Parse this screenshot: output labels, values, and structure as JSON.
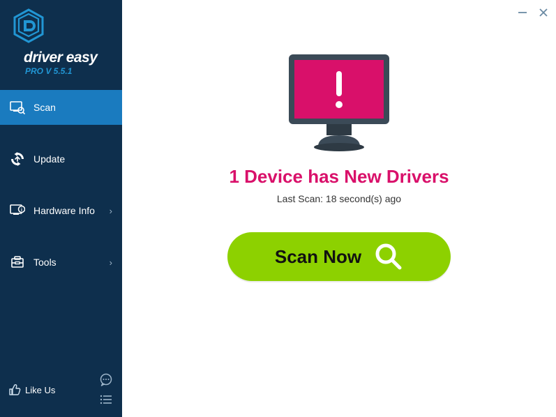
{
  "brand": {
    "name": "driver easy",
    "version_label": "PRO V 5.5.1"
  },
  "nav": {
    "items": [
      {
        "label": "Scan",
        "has_sub": false
      },
      {
        "label": "Update",
        "has_sub": false
      },
      {
        "label": "Hardware Info",
        "has_sub": true
      },
      {
        "label": "Tools",
        "has_sub": true
      }
    ]
  },
  "footer": {
    "like_us": "Like Us"
  },
  "main": {
    "headline": "1 Device has New Drivers",
    "last_scan": "Last Scan: 18 second(s) ago",
    "scan_button": "Scan Now"
  },
  "colors": {
    "sidebar_bg": "#0e2f4d",
    "active_bg": "#1a7bbf",
    "accent_pink": "#d9106a",
    "scan_green": "#8dd100"
  }
}
